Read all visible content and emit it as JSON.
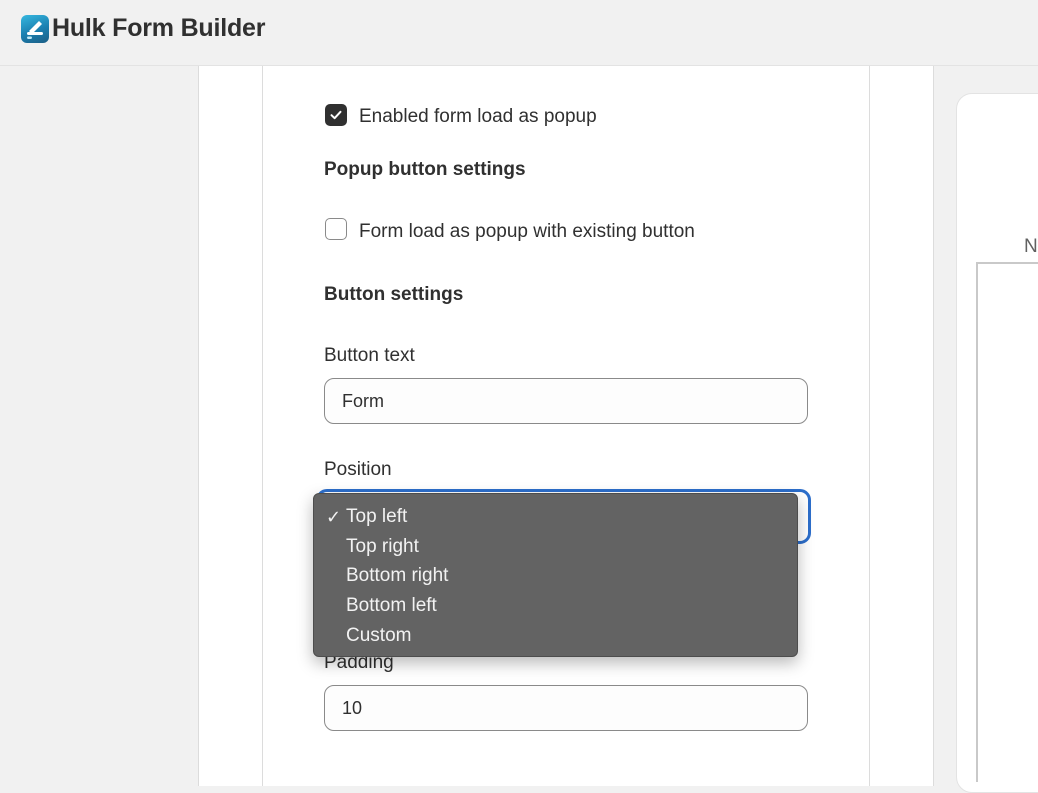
{
  "app": {
    "title": "Hulk Form Builder"
  },
  "popup": {
    "enabled_label": "Enabled form load as popup",
    "enabled_checked": true,
    "section_heading": "Popup button settings",
    "existing_button_label": "Form load as popup with existing button",
    "existing_button_checked": false
  },
  "button_settings": {
    "heading": "Button settings",
    "button_text_label": "Button text",
    "button_text_value": "Form",
    "position_label": "Position",
    "position_selected": "Top left",
    "position_options": [
      "Top left",
      "Top right",
      "Bottom right",
      "Bottom left",
      "Custom"
    ],
    "padding_label": "Padding",
    "padding_value": "10"
  },
  "preview": {
    "partial_text": "N"
  },
  "icons": {
    "logo": "hulk-logo-icon",
    "checkbox_check": "checkmark-icon",
    "selected_option": "checkmark-icon"
  },
  "colors": {
    "focus_ring": "#2c6ecb",
    "dropdown_bg": "#636363",
    "checkbox_checked": "#303030"
  }
}
